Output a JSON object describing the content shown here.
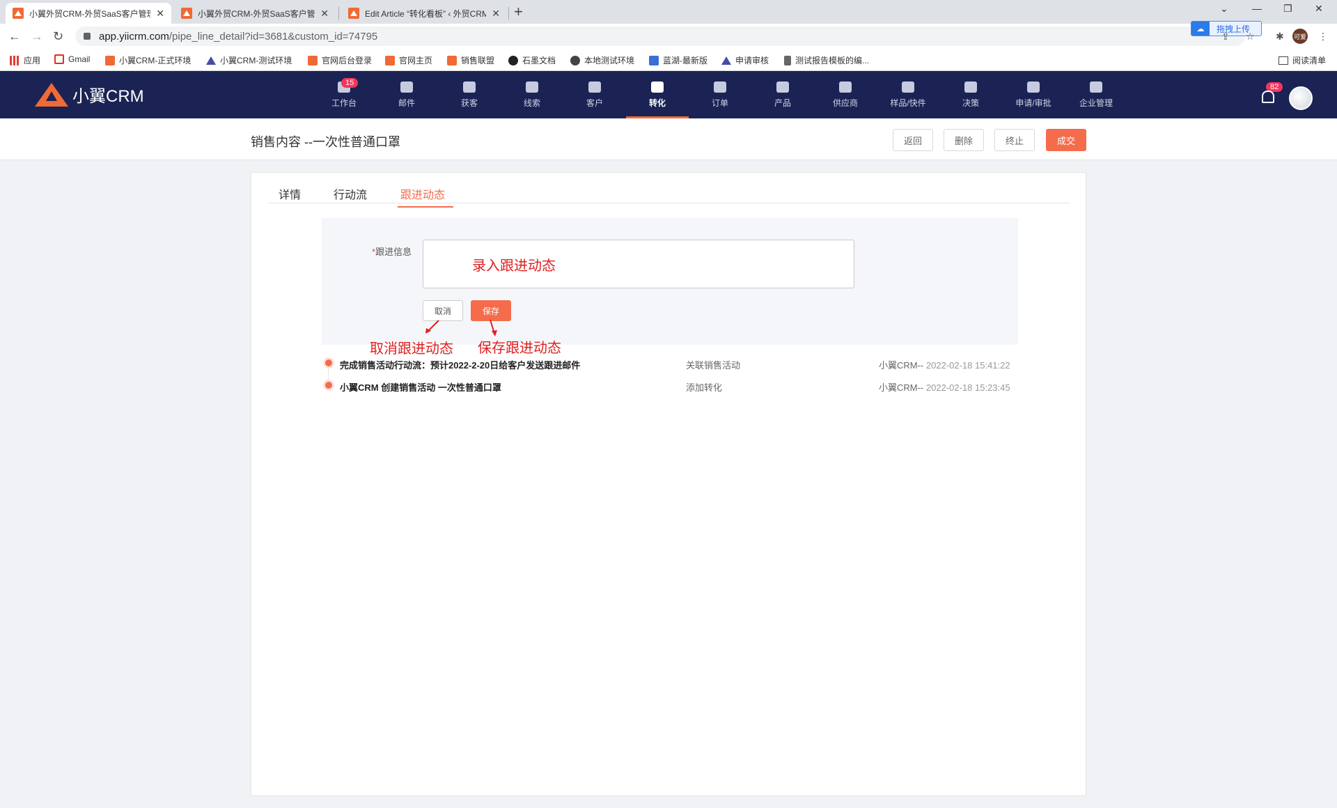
{
  "browser": {
    "tabs": [
      {
        "title": "小翼外贸CRM-外贸SaaS客户管理",
        "active": true
      },
      {
        "title": "小翼外贸CRM-外贸SaaS客户管理",
        "active": false
      },
      {
        "title": "Edit Article “转化看板” ‹ 外贸CRM",
        "active": false
      }
    ],
    "url_domain": "app.yiicrm.com",
    "url_path": "/pipe_line_detail?id=3681&custom_id=74795",
    "upload_label": "拖拽上传",
    "profile_label": "可爱",
    "bookmarks": [
      "应用",
      "Gmail",
      "小翼CRM-正式环境",
      "小翼CRM-测试环境",
      "官网后台登录",
      "官网主页",
      "销售联盟",
      "石墨文档",
      "本地测试环境",
      "蓝湖-最新版",
      "申请审核",
      "测试报告模板的编..."
    ],
    "reading_list": "阅读清单"
  },
  "app": {
    "logo": "小翼CRM",
    "nav": [
      {
        "label": "工作台",
        "badge": "15"
      },
      {
        "label": "邮件"
      },
      {
        "label": "获客"
      },
      {
        "label": "线索"
      },
      {
        "label": "客户"
      },
      {
        "label": "转化",
        "active": true
      },
      {
        "label": "订单"
      },
      {
        "label": "产品"
      },
      {
        "label": "供应商"
      },
      {
        "label": "样品/快件"
      },
      {
        "label": "决策"
      },
      {
        "label": "申请/审批"
      },
      {
        "label": "企业管理"
      }
    ],
    "notification_count": "82"
  },
  "page": {
    "title": "销售内容 --一次性普通口罩",
    "actions": {
      "back": "返回",
      "delete": "删除",
      "terminate": "终止",
      "deal": "成交"
    },
    "tabs": [
      "详情",
      "行动流",
      "跟进动态"
    ],
    "active_tab": "跟进动态",
    "form": {
      "label_required": "*",
      "label": "跟进信息",
      "textarea_value": "",
      "cancel": "取消",
      "save": "保存"
    },
    "annotations": {
      "input": "录入跟进动态",
      "cancel": "取消跟进动态",
      "save": "保存跟进动态"
    },
    "timeline": [
      {
        "text": "完成销售活动行动流：预计2022-2-20日给客户发送跟进邮件",
        "type": "关联销售活动",
        "who": "小翼CRM--",
        "time": "2022-02-18 15:41:22"
      },
      {
        "text": "小翼CRM 创建销售活动 一次性普通口罩",
        "type": "添加转化",
        "who": "小翼CRM--",
        "time": "2022-02-18 15:23:45"
      }
    ]
  }
}
